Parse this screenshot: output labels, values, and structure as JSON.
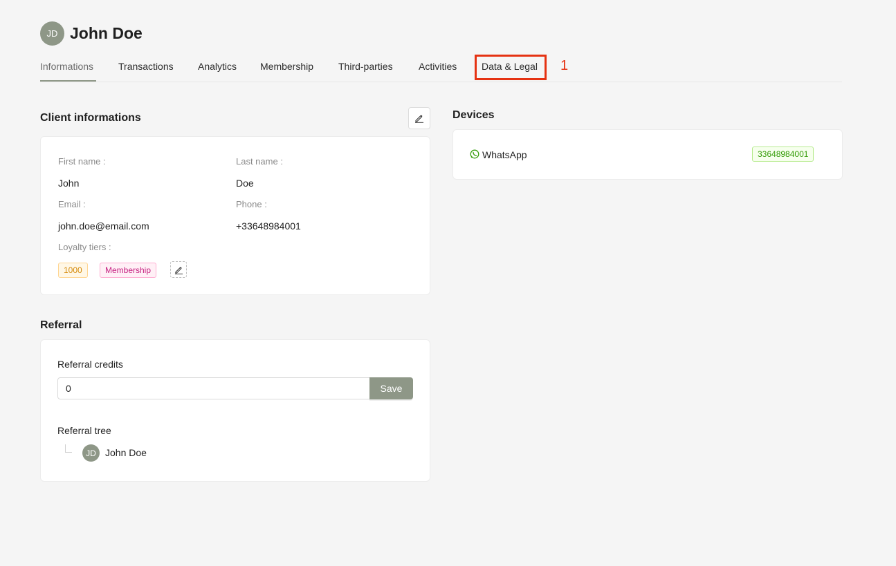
{
  "profile": {
    "initials": "JD",
    "name": "John Doe"
  },
  "tabs": [
    {
      "label": "Informations",
      "active": true
    },
    {
      "label": "Transactions"
    },
    {
      "label": "Analytics"
    },
    {
      "label": "Membership"
    },
    {
      "label": "Third-parties"
    },
    {
      "label": "Activities"
    },
    {
      "label": "Data & Legal",
      "highlighted": true
    }
  ],
  "annotation": {
    "number": "1",
    "color": "#e53212"
  },
  "client_info": {
    "title": "Client informations",
    "first_name_label": "First name :",
    "first_name": "John",
    "last_name_label": "Last name :",
    "last_name": "Doe",
    "email_label": "Email :",
    "email": "john.doe@email.com",
    "phone_label": "Phone :",
    "phone": "+33648984001",
    "loyalty_label": "Loyalty tiers :",
    "loyalty_tags": [
      "1000",
      "Membership"
    ]
  },
  "devices": {
    "title": "Devices",
    "items": [
      {
        "icon": "whatsapp-icon",
        "label": "WhatsApp",
        "value": "33648984001"
      }
    ]
  },
  "referral": {
    "title": "Referral",
    "credits_label": "Referral credits",
    "credits_value": "0",
    "save_label": "Save",
    "tree_label": "Referral tree",
    "tree": [
      {
        "initials": "JD",
        "name": "John Doe"
      }
    ]
  },
  "colors": {
    "accent": "#8e9787",
    "background": "#f5f5f5"
  }
}
